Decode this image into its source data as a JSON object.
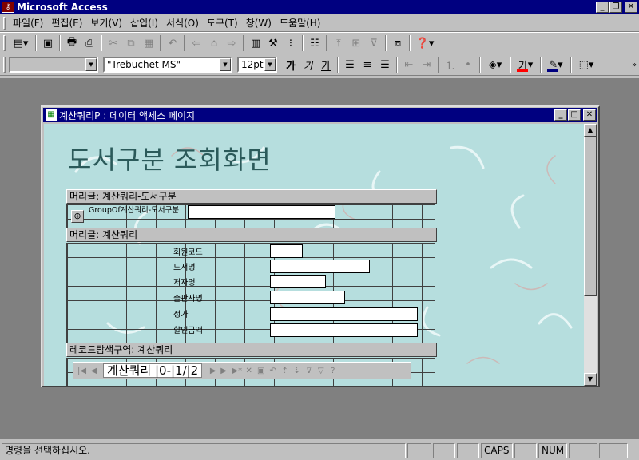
{
  "app": {
    "title": "Microsoft Access",
    "caption_buttons": [
      "_",
      "❐",
      "✕"
    ]
  },
  "menu": [
    "파일(F)",
    "편집(E)",
    "보기(V)",
    "삽입(I)",
    "서식(O)",
    "도구(T)",
    "창(W)",
    "도움말(H)"
  ],
  "format_toolbar": {
    "object_combo": "",
    "font_combo": "\"Trebuchet MS\"",
    "size_combo": "12pt",
    "bold": "가",
    "italic": "가",
    "underline": "가",
    "font_color_glyph": "가"
  },
  "child_window": {
    "title": "계산쿼리P : 데이터 액세스 페이지",
    "caption_buttons": [
      "_",
      "□",
      "✕"
    ]
  },
  "page": {
    "title": "도서구분 조회화면",
    "section1_header": "머리글: 계산쿼리-도서구분",
    "group_label": "GroupOf계산쿼리-도서구분",
    "section2_header": "머리글: 계산쿼리",
    "fields": [
      {
        "label": "회원코드"
      },
      {
        "label": "도서명"
      },
      {
        "label": "저자명"
      },
      {
        "label": "출판사명"
      },
      {
        "label": "정가"
      },
      {
        "label": "할인금액"
      }
    ],
    "section3_header": "레코드탐색구역: 계산쿼리",
    "nav_text": "계산쿼리 |0-|1/|2"
  },
  "status": {
    "message": "명령을 선택하십시오.",
    "caps": "CAPS",
    "num": "NUM"
  },
  "colors": {
    "title_bar": "#000080",
    "workspace": "#808080",
    "page_bg": "#b6dede",
    "page_title": "#2b5a5a",
    "font_color_swatch": "#ff0000",
    "highlight_swatch": "#000080"
  }
}
